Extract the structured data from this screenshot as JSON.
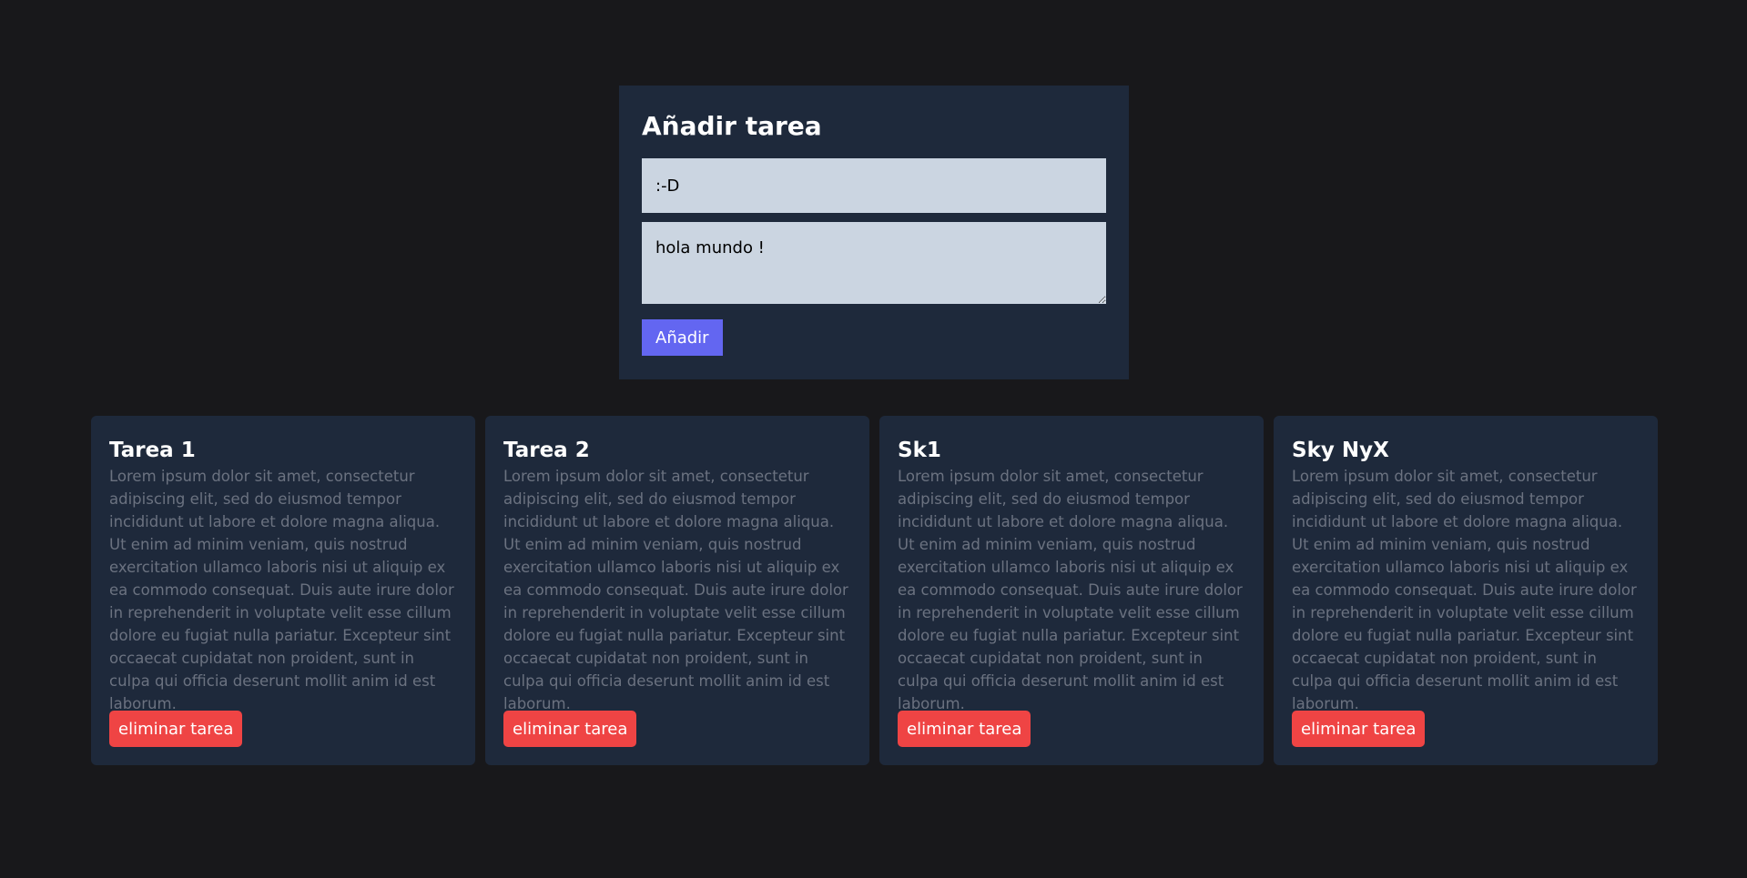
{
  "form": {
    "title": "Añadir tarea",
    "title_value": ":-D",
    "description_value": "hola mundo !",
    "submit_label": "Añadir"
  },
  "tasks": [
    {
      "title": "Tarea 1",
      "description": "Lorem ipsum dolor sit amet, consectetur adipiscing elit, sed do eiusmod tempor incididunt ut labore et dolore magna aliqua. Ut enim ad minim veniam, quis nostrud exercitation ullamco laboris nisi ut aliquip ex ea commodo consequat. Duis aute irure dolor in reprehenderit in voluptate velit esse cillum dolore eu fugiat nulla pariatur. Excepteur sint occaecat cupidatat non proident, sunt in culpa qui officia deserunt mollit anim id est laborum.",
      "delete_label": "eliminar tarea"
    },
    {
      "title": "Tarea 2",
      "description": "Lorem ipsum dolor sit amet, consectetur adipiscing elit, sed do eiusmod tempor incididunt ut labore et dolore magna aliqua. Ut enim ad minim veniam, quis nostrud exercitation ullamco laboris nisi ut aliquip ex ea commodo consequat. Duis aute irure dolor in reprehenderit in voluptate velit esse cillum dolore eu fugiat nulla pariatur. Excepteur sint occaecat cupidatat non proident, sunt in culpa qui officia deserunt mollit anim id est laborum.",
      "delete_label": "eliminar tarea"
    },
    {
      "title": "Sk1",
      "description": "Lorem ipsum dolor sit amet, consectetur adipiscing elit, sed do eiusmod tempor incididunt ut labore et dolore magna aliqua. Ut enim ad minim veniam, quis nostrud exercitation ullamco laboris nisi ut aliquip ex ea commodo consequat. Duis aute irure dolor in reprehenderit in voluptate velit esse cillum dolore eu fugiat nulla pariatur. Excepteur sint occaecat cupidatat non proident, sunt in culpa qui officia deserunt mollit anim id est laborum.",
      "delete_label": "eliminar tarea"
    },
    {
      "title": "Sky NyX",
      "description": "Lorem ipsum dolor sit amet, consectetur adipiscing elit, sed do eiusmod tempor incididunt ut labore et dolore magna aliqua. Ut enim ad minim veniam, quis nostrud exercitation ullamco laboris nisi ut aliquip ex ea commodo consequat. Duis aute irure dolor in reprehenderit in voluptate velit esse cillum dolore eu fugiat nulla pariatur. Excepteur sint occaecat cupidatat non proident, sunt in culpa qui officia deserunt mollit anim id est laborum.",
      "delete_label": "eliminar tarea"
    }
  ],
  "colors": {
    "page_background": "#18181b",
    "card_background": "#1e293b",
    "input_background": "#cbd5e1",
    "add_button": "#6366f1",
    "delete_button": "#ef4444",
    "description_text": "#6b7280"
  }
}
